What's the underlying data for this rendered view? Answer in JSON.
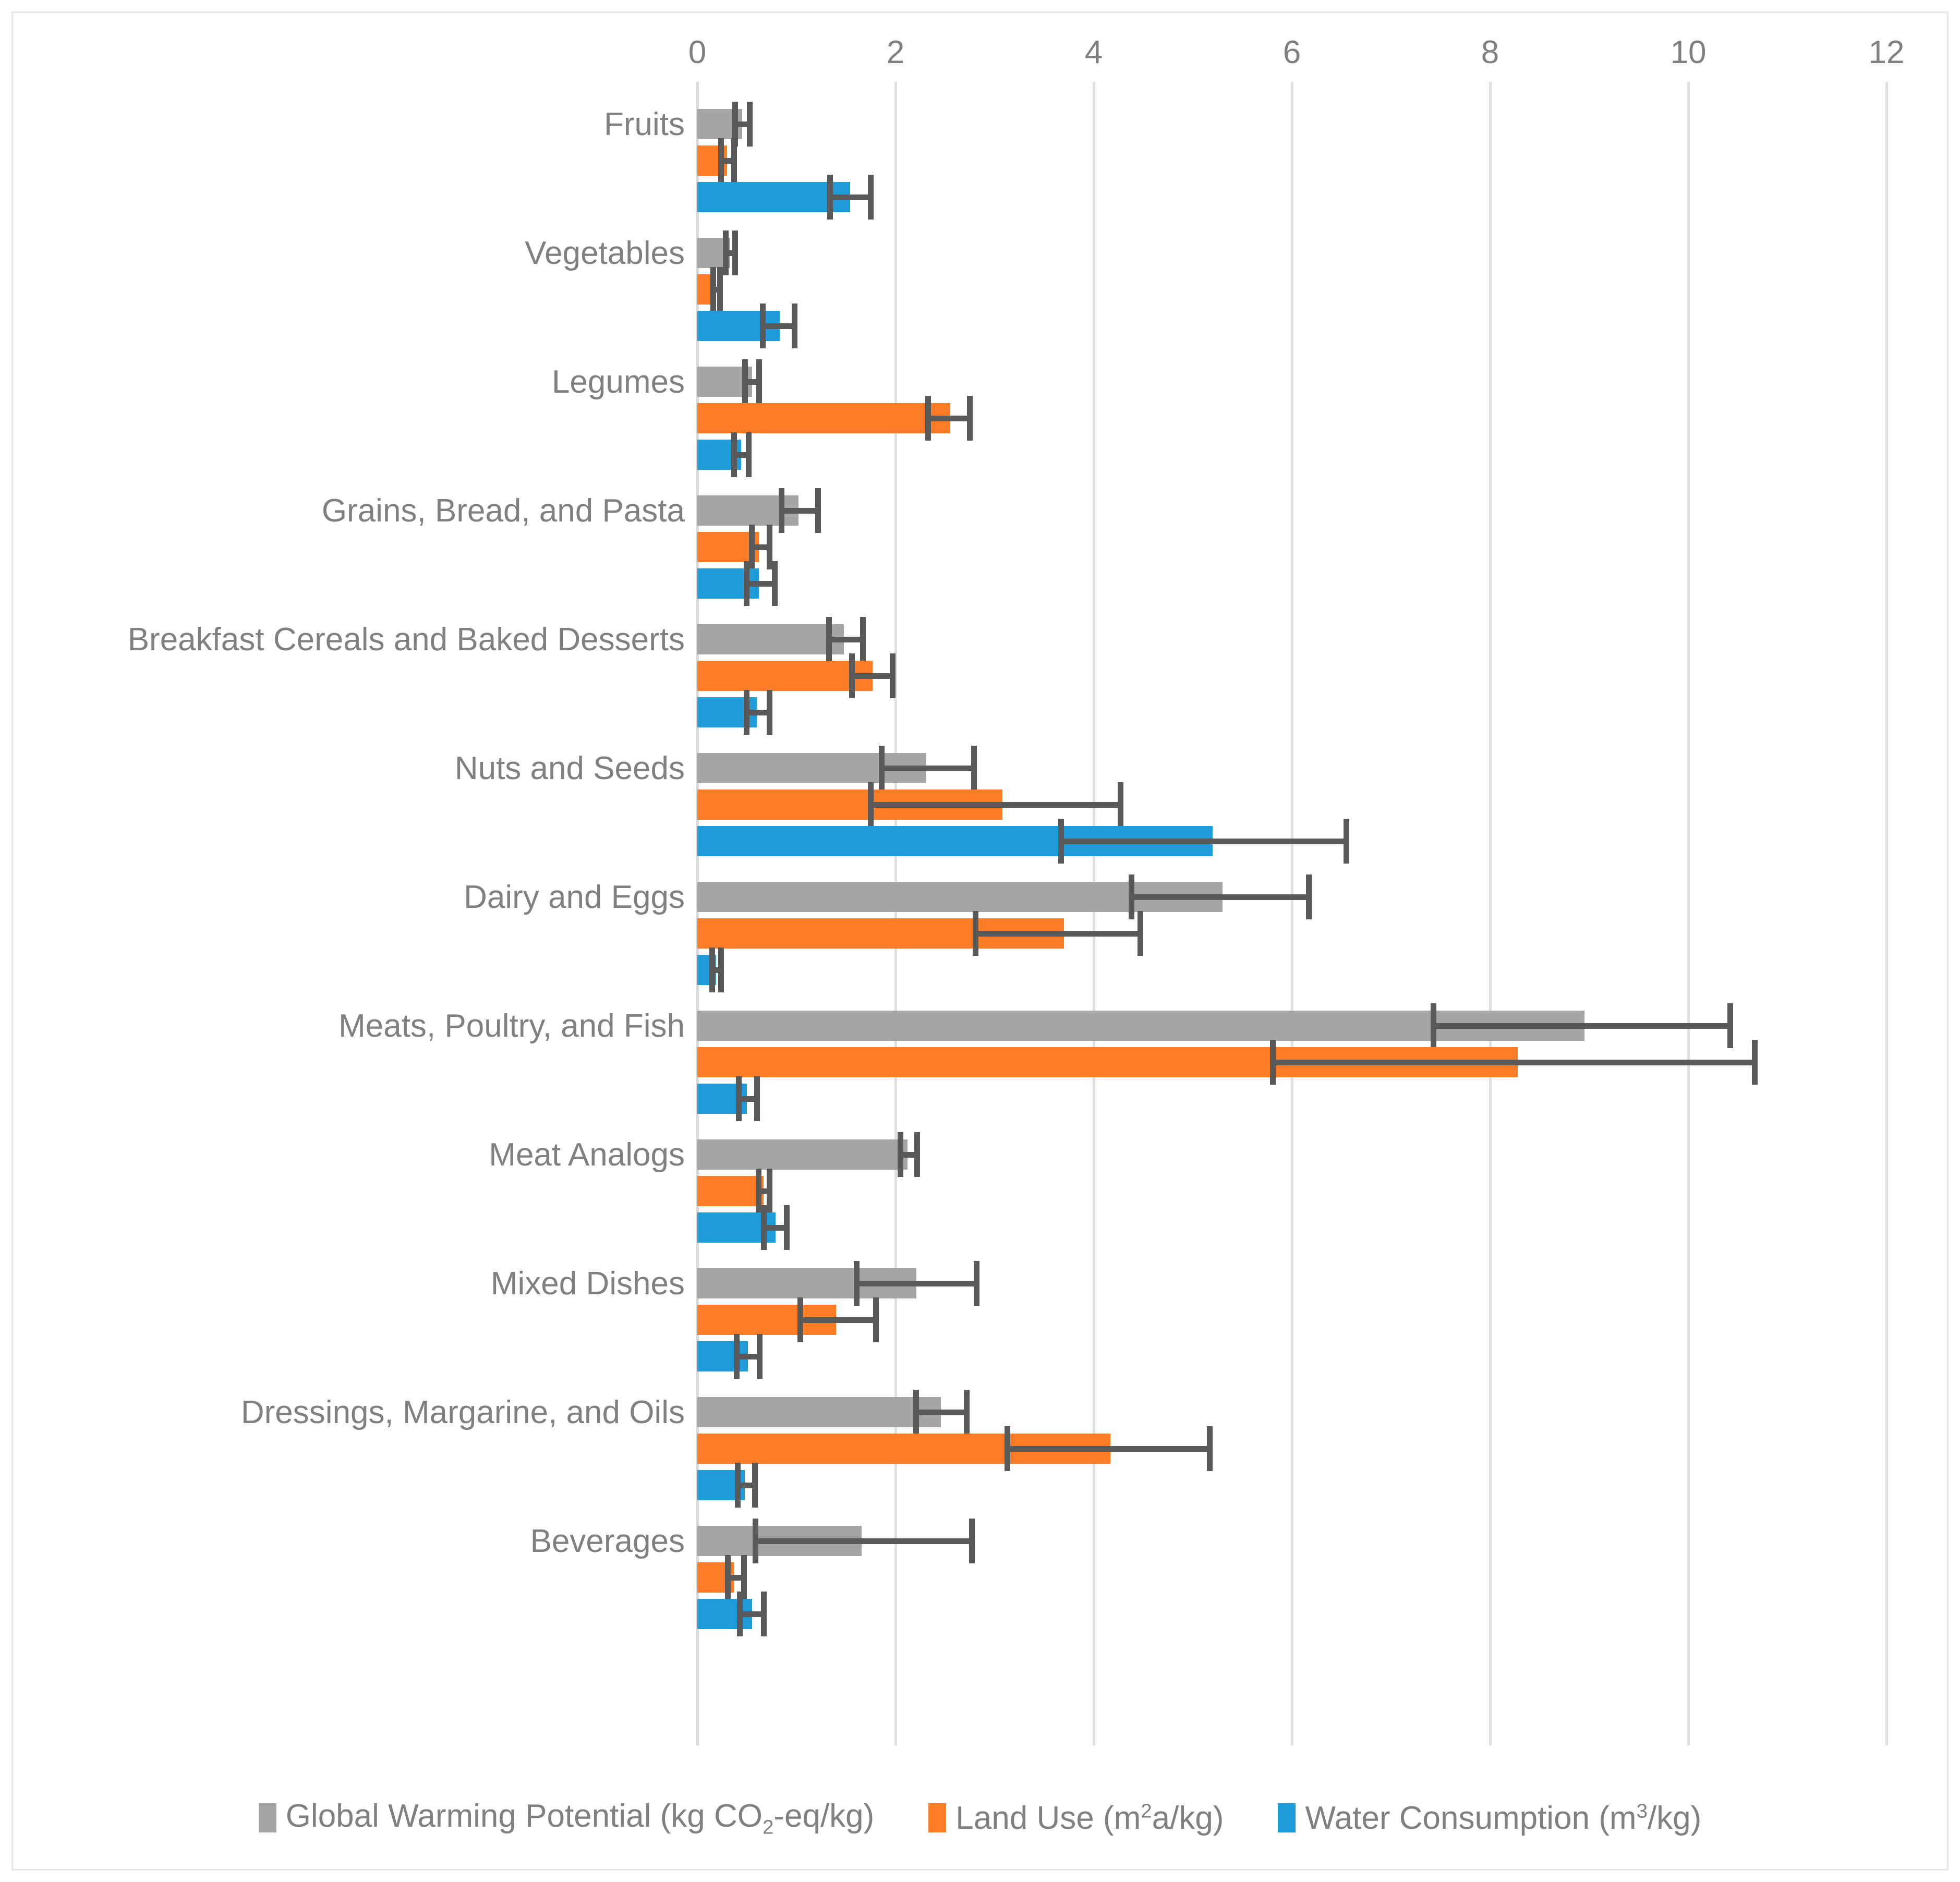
{
  "chart_data": {
    "type": "bar",
    "orientation": "horizontal",
    "title": "",
    "xlabel": "",
    "ylabel": "",
    "xlim": [
      0,
      12
    ],
    "xticks": [
      0,
      2,
      4,
      6,
      8,
      10,
      12
    ],
    "xtick_labels": [
      "0",
      "2",
      "4",
      "6",
      "8",
      "10",
      "12"
    ],
    "grid": true,
    "legend_position": "bottom",
    "categories": [
      "Fruits",
      "Vegetables",
      "Legumes",
      "Grains, Bread, and Pasta",
      "Breakfast Cereals and Baked Desserts",
      "Nuts and Seeds",
      "Dairy and Eggs",
      "Meats, Poultry, and Fish",
      "Meat Analogs",
      "Mixed Dishes",
      "Dressings, Margarine, and Oils",
      "Beverages"
    ],
    "series": [
      {
        "name": "Global Warming Potential (kg CO₂-eq/kg)",
        "color": "#a5a5a5",
        "values": [
          0.45,
          0.33,
          0.55,
          1.02,
          1.48,
          2.31,
          5.3,
          8.95,
          2.12,
          2.21,
          2.46,
          1.66
        ],
        "err_low": [
          0.35,
          0.26,
          0.45,
          0.82,
          1.3,
          1.83,
          4.35,
          7.4,
          2.02,
          1.58,
          2.18,
          0.56
        ],
        "err_high": [
          0.56,
          0.41,
          0.65,
          1.25,
          1.7,
          2.82,
          6.2,
          10.45,
          2.25,
          2.85,
          2.75,
          2.8
        ]
      },
      {
        "name": "Land Use (m²a/kg)",
        "color": "#fc7d25",
        "values": [
          0.3,
          0.19,
          2.55,
          0.62,
          1.77,
          3.08,
          3.7,
          8.28,
          0.67,
          1.4,
          4.17,
          0.37
        ],
        "err_low": [
          0.21,
          0.13,
          2.3,
          0.52,
          1.53,
          1.72,
          2.78,
          5.78,
          0.59,
          1.01,
          3.1,
          0.28
        ],
        "err_high": [
          0.4,
          0.26,
          2.78,
          0.76,
          2.0,
          4.3,
          4.5,
          10.7,
          0.76,
          1.83,
          5.2,
          0.5
        ]
      },
      {
        "name": "Water Consumption (m³/kg)",
        "color": "#1f9bd9",
        "values": [
          1.54,
          0.83,
          0.44,
          0.62,
          0.6,
          5.2,
          0.19,
          0.5,
          0.79,
          0.51,
          0.48,
          0.55
        ],
        "err_low": [
          1.31,
          0.63,
          0.34,
          0.47,
          0.47,
          3.64,
          0.12,
          0.39,
          0.64,
          0.37,
          0.38,
          0.4
        ],
        "err_high": [
          1.78,
          1.01,
          0.55,
          0.81,
          0.76,
          6.58,
          0.27,
          0.63,
          0.93,
          0.66,
          0.61,
          0.7
        ]
      }
    ]
  },
  "legend": {
    "items": [
      {
        "label": "Global Warming Potential (kg CO₂-eq/kg)",
        "color": "#a5a5a5"
      },
      {
        "label": "Land Use (m²a/kg)",
        "color": "#fc7d25"
      },
      {
        "label": "Water Consumption (m³/kg)",
        "color": "#1f9bd9"
      }
    ]
  },
  "colors": {
    "gwp": "#a5a5a5",
    "land": "#fc7d25",
    "water": "#1f9bd9",
    "error_bar": "#595959",
    "gridline": "#e0e0e0",
    "text": "#808080",
    "border": "#e6e6e6",
    "background": "#ffffff"
  }
}
